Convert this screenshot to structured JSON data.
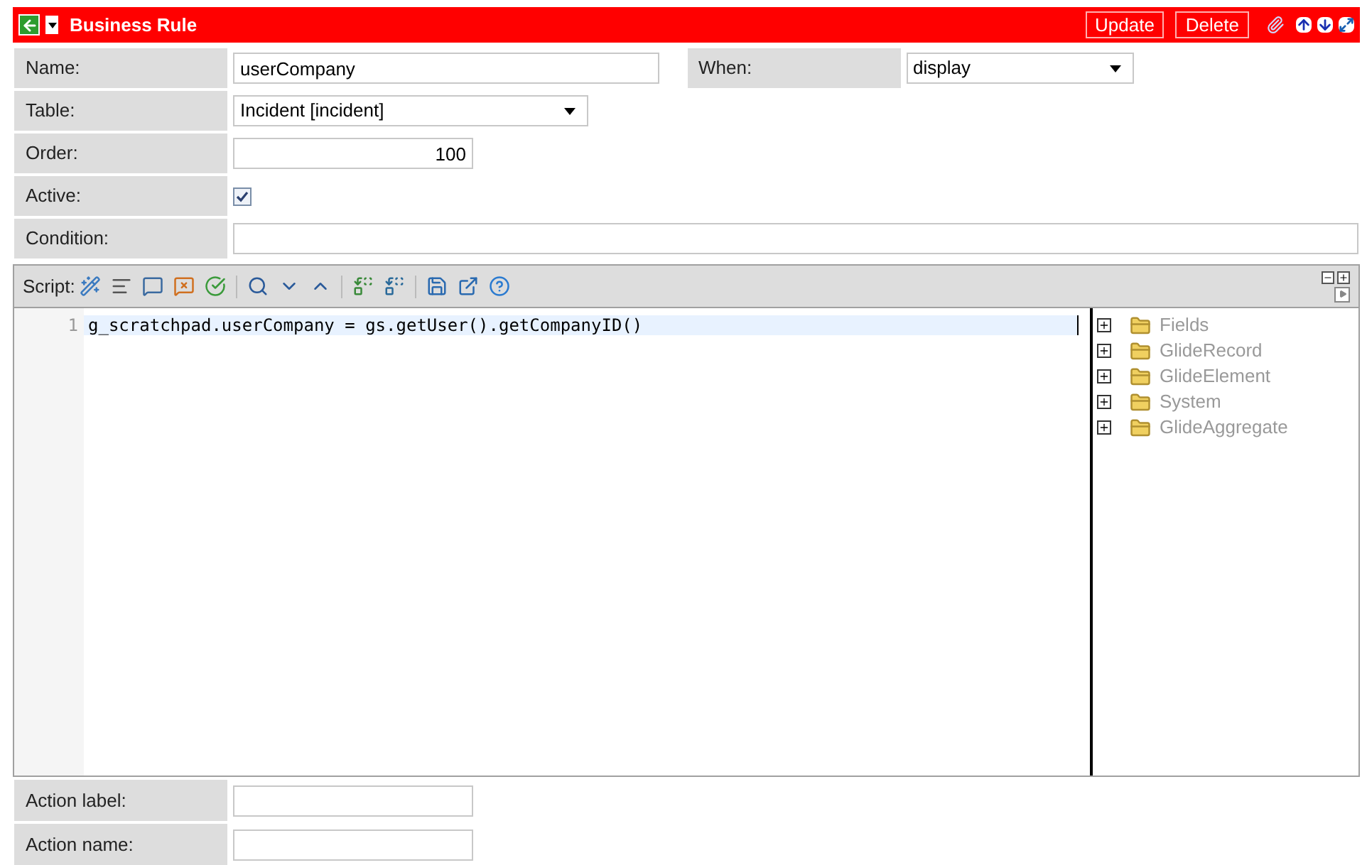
{
  "header": {
    "title": "Business Rule",
    "buttons": [
      "Update",
      "Delete"
    ]
  },
  "rows": [
    {
      "fields": [
        {
          "label": "Name:",
          "kind": "text",
          "value": "userCompany"
        },
        {
          "label": "When:",
          "kind": "select",
          "value": "display"
        }
      ]
    },
    {
      "fields": [
        {
          "label": "Table:",
          "kind": "select",
          "value": "Incident [incident]"
        }
      ]
    },
    {
      "fields": [
        {
          "label": "Order:",
          "kind": "number",
          "value": "100"
        }
      ]
    },
    {
      "fields": [
        {
          "label": "Active:",
          "kind": "checkbox",
          "checked": true
        }
      ]
    },
    {
      "fields": [
        {
          "label": "Condition:",
          "kind": "wide"
        }
      ]
    }
  ],
  "script": {
    "label": "Script:",
    "lines": [
      {
        "number": "1",
        "code": "g_scratchpad.userCompany = gs.getUser().getCompanyID()"
      }
    ],
    "tree": [
      {
        "label": "Fields",
        "expanded": false
      },
      {
        "label": "GlideRecord",
        "expanded": false
      },
      {
        "label": "GlideElement",
        "expanded": false
      },
      {
        "label": "System",
        "expanded": false
      },
      {
        "label": "GlideAggregate",
        "expanded": false
      }
    ]
  },
  "bottom_rows": [
    {
      "label": "Action label:"
    },
    {
      "label": "Action name:"
    }
  ]
}
